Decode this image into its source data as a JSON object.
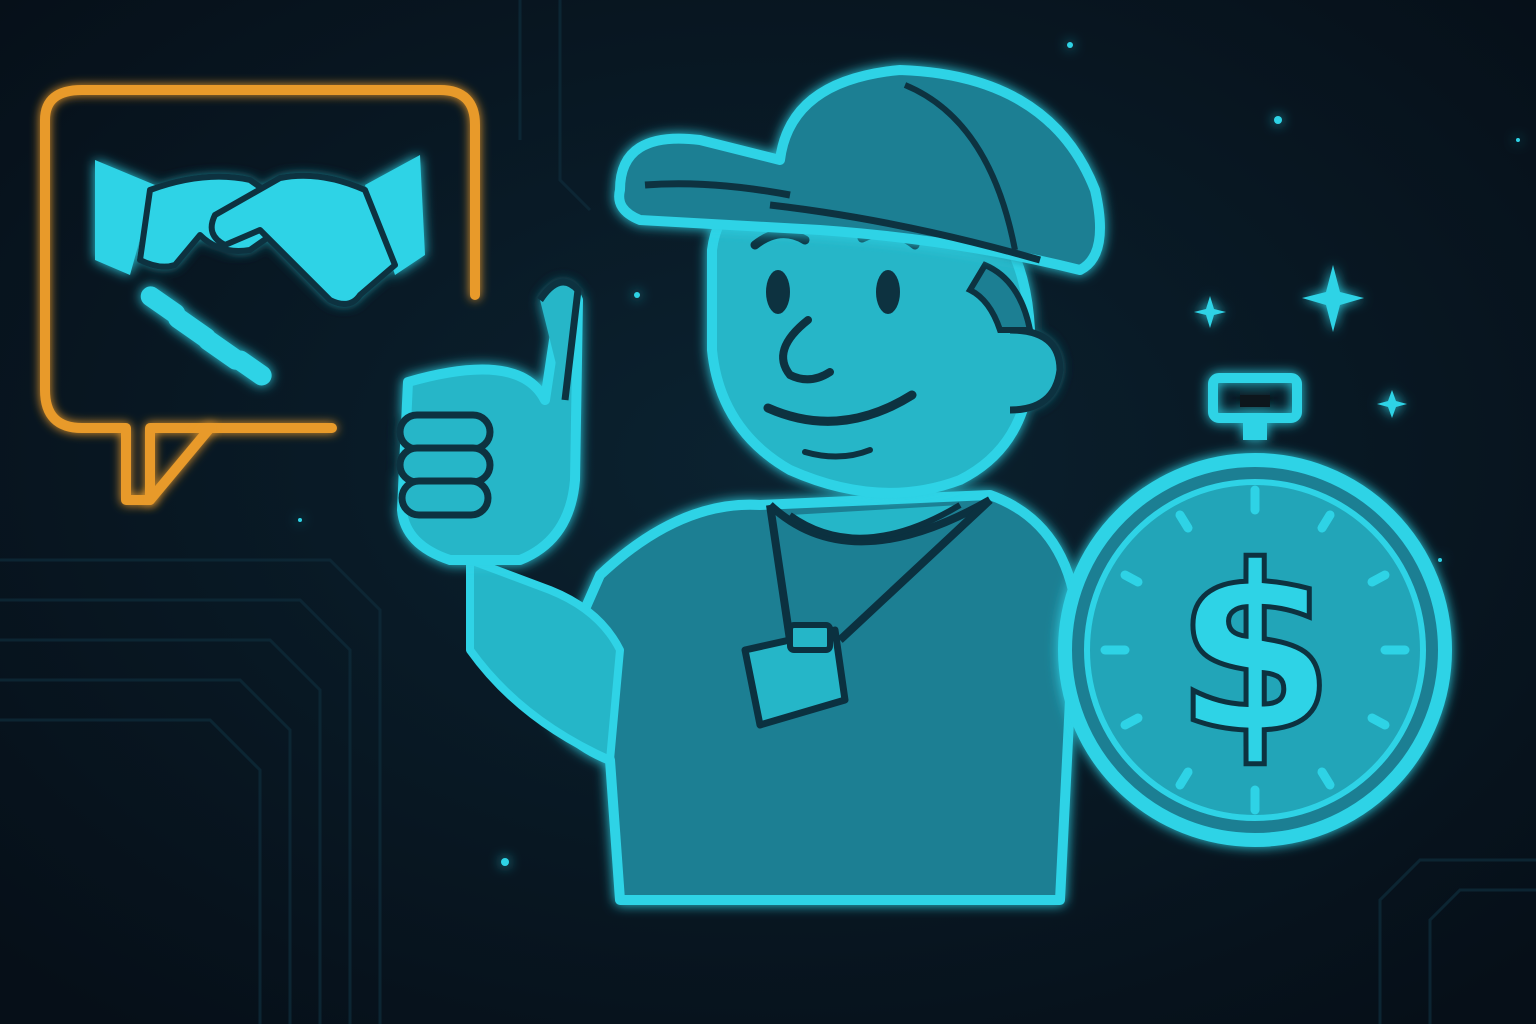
{
  "scene": {
    "description_icons": [
      "handshake-icon",
      "thumbs-up-mascot",
      "stopwatch-icon",
      "dollar-sign-icon",
      "sparkle-icon",
      "whistle-icon"
    ],
    "colors": {
      "background": "#07141f",
      "background_vignette": "#0b2230",
      "accent_cyan": "#2fd3e6",
      "fill_cyan": "#25b6c8",
      "fill_cyan_dark": "#1a7f93",
      "line_dark": "#0b3140",
      "accent_orange": "#e89a2c",
      "circuit_lines": "#0e2a38"
    }
  },
  "stopwatch": {
    "symbol": "$"
  }
}
